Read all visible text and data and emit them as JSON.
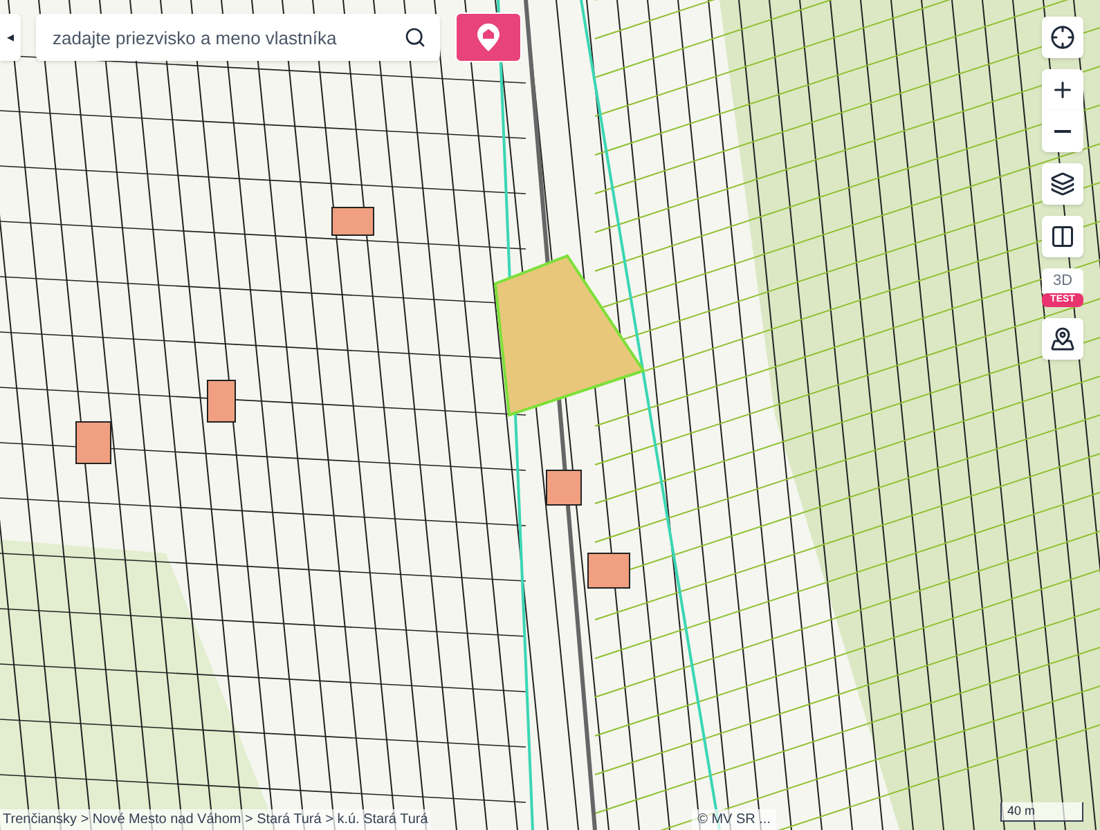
{
  "search": {
    "placeholder": "zadajte priezvisko a meno vlastníka"
  },
  "collapse_button": {
    "label": "◂"
  },
  "map_controls": [
    {
      "kind": "locate"
    },
    {
      "kind": "zoom_in"
    },
    {
      "kind": "zoom_out"
    },
    {
      "kind": "layers"
    },
    {
      "kind": "compare"
    },
    {
      "kind": "threed",
      "label": "3D",
      "badge": "TEST"
    },
    {
      "kind": "photo_pin"
    }
  ],
  "breadcrumb": "Trenčiansky > Nové Mesto nad Váhom > Stará Turá > k.ú. Stará Turá",
  "attribution": "© MV SR ...",
  "scale": "40 m"
}
